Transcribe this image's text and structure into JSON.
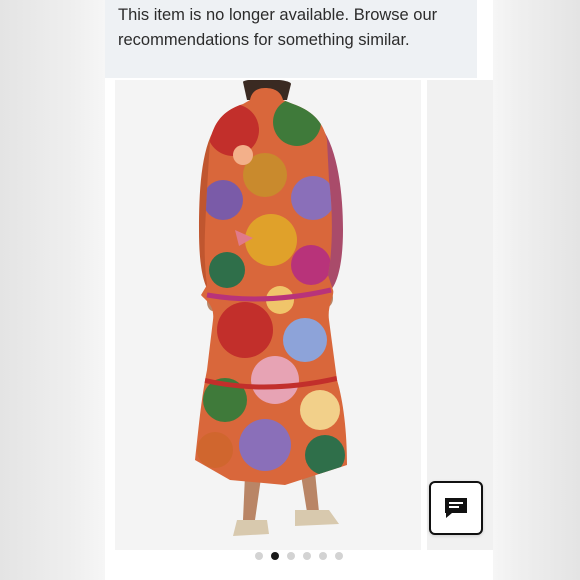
{
  "banner": {
    "message": "This item is no longer available. Browse our recommendations for something similar."
  },
  "product_image": {
    "alt": "Back view of a model wearing a long-sleeve tiered maxi dress with a colorful patchwork print"
  },
  "chat": {
    "icon": "chat-bubble-icon"
  },
  "carousel": {
    "total": 6,
    "active_index": 1
  },
  "colors": {
    "banner_bg": "#eef1f4",
    "text": "#2c2c2c",
    "dot_active": "#1a1a1a",
    "dot_inactive": "#d3d3d3"
  }
}
